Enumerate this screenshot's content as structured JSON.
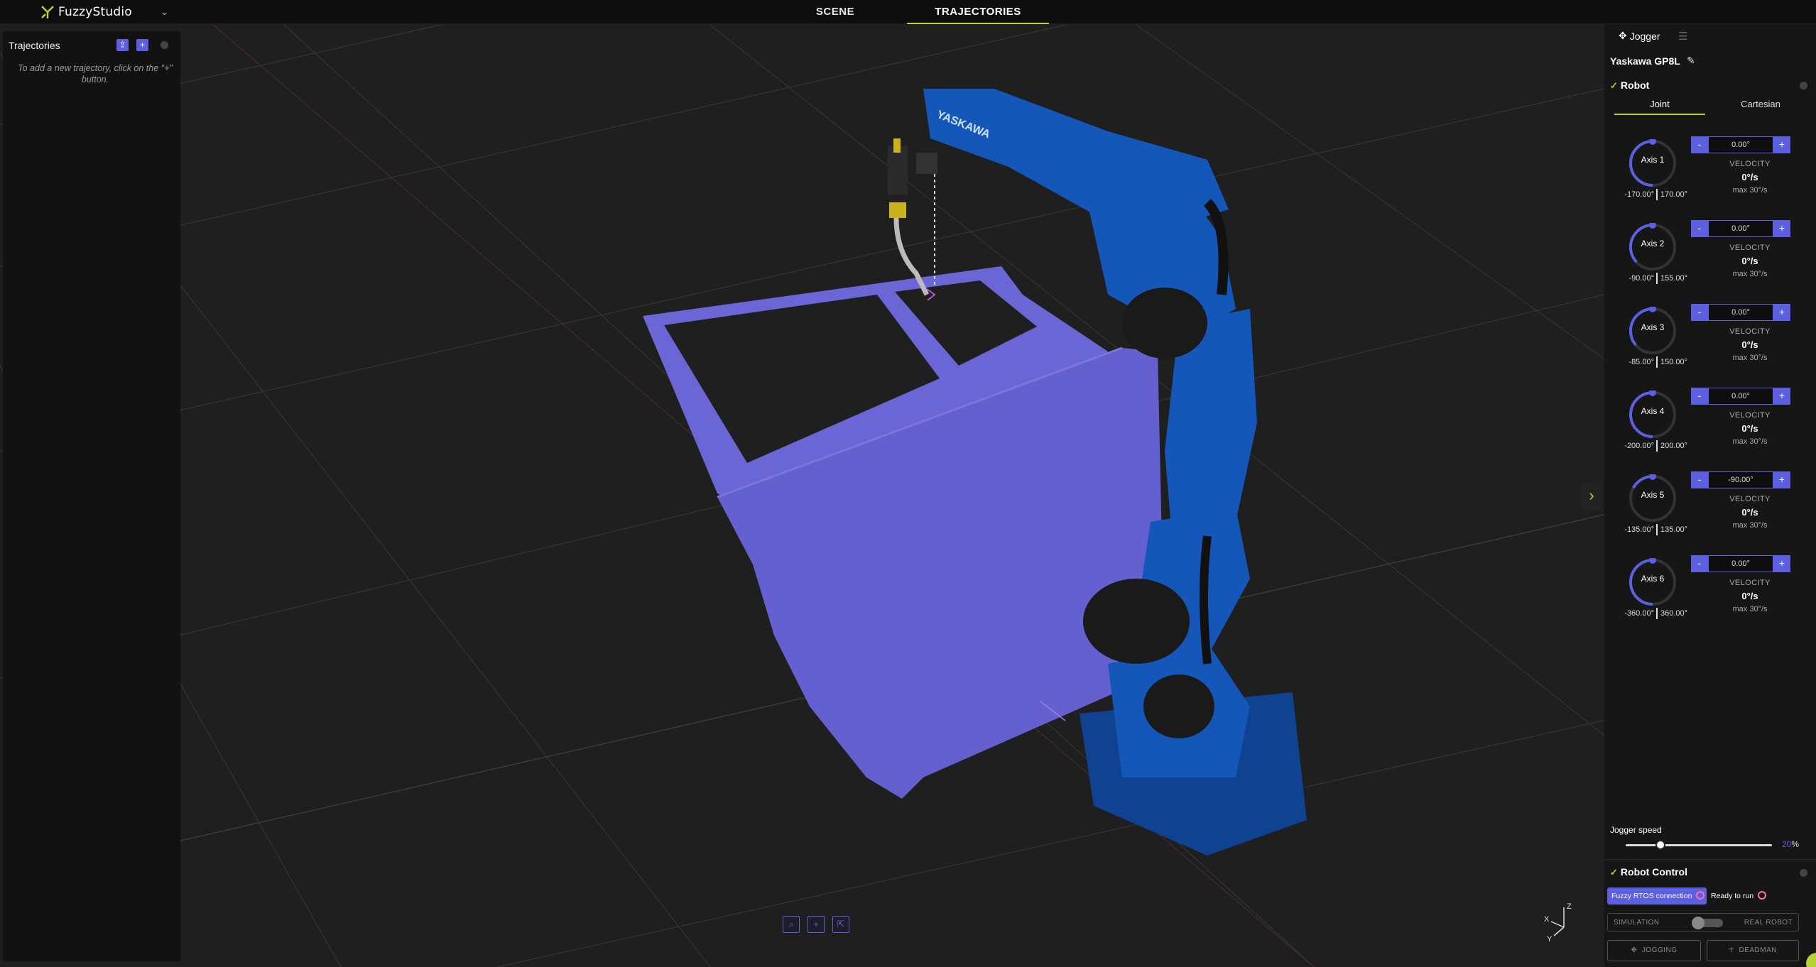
{
  "app": {
    "name": "FuzzyStudio"
  },
  "tabs": [
    {
      "label": "SCENE",
      "active": false
    },
    {
      "label": "TRAJECTORIES",
      "active": true
    }
  ],
  "trajectories_panel": {
    "title": "Trajectories",
    "add_button": "+",
    "hint": "To add a new trajectory, click on the \"+\" button."
  },
  "right_panel": {
    "tab": "Jogger",
    "robot_name": "Yaskawa GP8L",
    "robot_section": "Robot",
    "mode_tabs": [
      "Joint",
      "Cartesian"
    ],
    "axes": [
      {
        "name": "Axis 1",
        "value": "0.00°",
        "min": "-170.00°",
        "max": "170.00°",
        "velocity_label": "VELOCITY",
        "velocity": "0°/s",
        "max_velocity": "max 30°/s",
        "fraction": 0.5
      },
      {
        "name": "Axis 2",
        "value": "0.00°",
        "min": "-90.00°",
        "max": "155.00°",
        "velocity_label": "VELOCITY",
        "velocity": "0°/s",
        "max_velocity": "max 30°/s",
        "fraction": 0.37
      },
      {
        "name": "Axis 3",
        "value": "0.00°",
        "min": "-85.00°",
        "max": "150.00°",
        "velocity_label": "VELOCITY",
        "velocity": "0°/s",
        "max_velocity": "max 30°/s",
        "fraction": 0.36
      },
      {
        "name": "Axis 4",
        "value": "0.00°",
        "min": "-200.00°",
        "max": "200.00°",
        "velocity_label": "VELOCITY",
        "velocity": "0°/s",
        "max_velocity": "max 30°/s",
        "fraction": 0.5
      },
      {
        "name": "Axis 5",
        "value": "-90.00°",
        "min": "-135.00°",
        "max": "135.00°",
        "velocity_label": "VELOCITY",
        "velocity": "0°/s",
        "max_velocity": "max 30°/s",
        "fraction": 0.17
      },
      {
        "name": "Axis 6",
        "value": "0.00°",
        "min": "-360.00°",
        "max": "360.00°",
        "velocity_label": "VELOCITY",
        "velocity": "0°/s",
        "max_velocity": "max 30°/s",
        "fraction": 0.5
      }
    ],
    "jogger_speed_label": "Jogger speed",
    "jogger_speed_value": "20",
    "jogger_speed_unit": "%",
    "robot_control": {
      "title": "Robot Control",
      "rtos_connection": "Fuzzy RTOS connection",
      "ready_label": "Ready to run",
      "simulation_label": "SIMULATION",
      "real_robot_label": "REAL ROBOT",
      "jogging_label": "JOGGING",
      "deadman_label": "DEADMAN"
    }
  },
  "viewport": {
    "robot_brand": "YASKAWA",
    "axis_labels": {
      "x": "X",
      "y": "Y",
      "z": "Z"
    }
  },
  "colors": {
    "accent": "#b7d233",
    "primary": "#5b5fe0",
    "robot_blue": "#1557b8",
    "door": "#6b66d6",
    "background": "#1e1e1e"
  }
}
